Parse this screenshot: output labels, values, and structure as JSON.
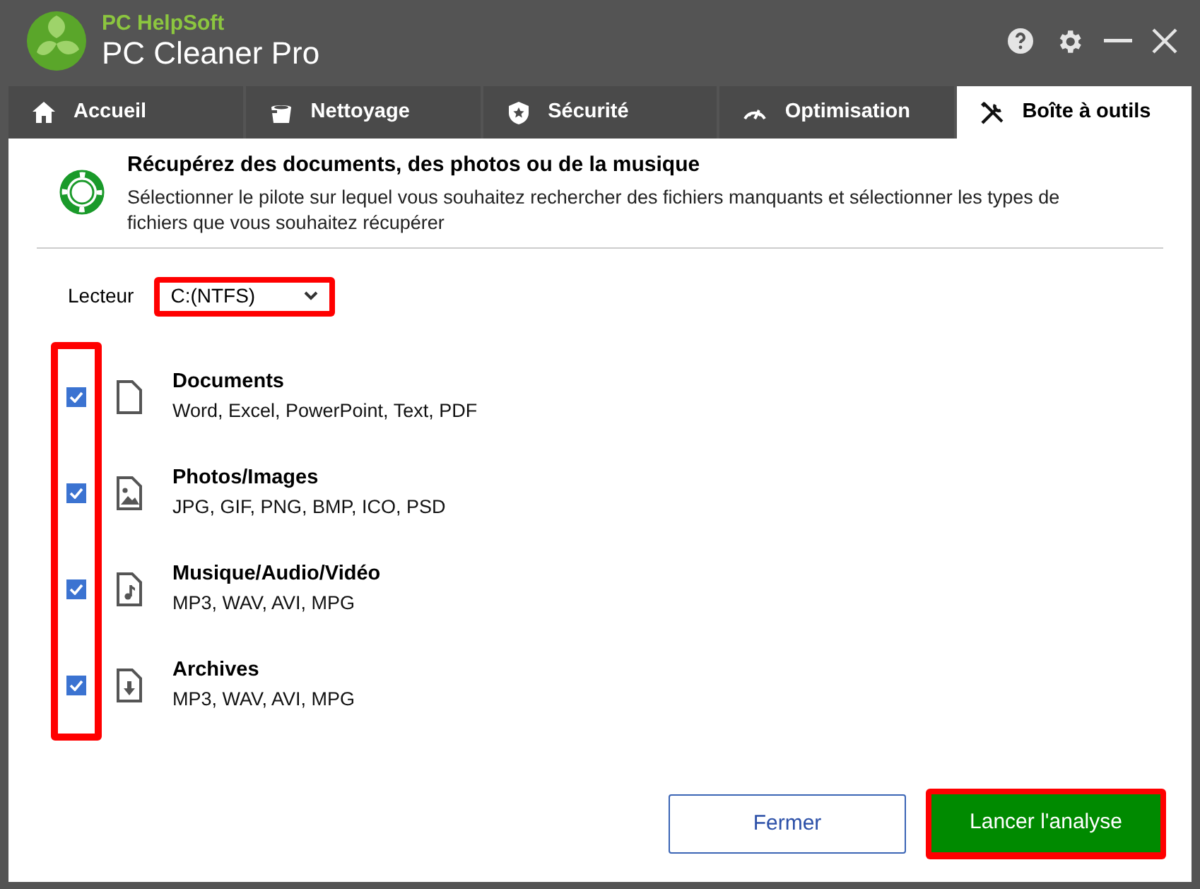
{
  "app": {
    "brand": "PC HelpSoft",
    "title": "PC Cleaner Pro"
  },
  "tabs": [
    {
      "label": "Accueil",
      "kind": "home",
      "selected": false
    },
    {
      "label": "Nettoyage",
      "kind": "cleaning",
      "selected": false
    },
    {
      "label": "Sécurité",
      "kind": "security",
      "selected": false
    },
    {
      "label": "Optimisation",
      "kind": "optimization",
      "selected": false
    },
    {
      "label": "Boîte à outils",
      "kind": "toolbox",
      "selected": true
    }
  ],
  "header": {
    "title": "Récupérez des documents, des photos ou de la musique",
    "description": "Sélectionner le pilote sur lequel vous souhaitez rechercher des fichiers manquants et sélectionner les types de fichiers que vous souhaitez récupérer"
  },
  "drive": {
    "label": "Lecteur",
    "value": "C:(NTFS)",
    "highlighted": true
  },
  "checkboxes_highlighted": true,
  "file_types": [
    {
      "kind": "document",
      "name": "Documents",
      "formats": "Word, Excel, PowerPoint, Text, PDF",
      "checked": true
    },
    {
      "kind": "image",
      "name": "Photos/Images",
      "formats": "JPG, GIF, PNG, BMP, ICO, PSD",
      "checked": true
    },
    {
      "kind": "audio",
      "name": "Musique/Audio/Vidéo",
      "formats": "MP3, WAV, AVI, MPG",
      "checked": true
    },
    {
      "kind": "archive",
      "name": "Archives",
      "formats": "MP3, WAV, AVI, MPG",
      "checked": true
    }
  ],
  "buttons": [
    {
      "kind": "secondary",
      "label": "Fermer",
      "highlighted": false
    },
    {
      "kind": "primary",
      "label": "Lancer l'analyse",
      "highlighted": true
    }
  ]
}
